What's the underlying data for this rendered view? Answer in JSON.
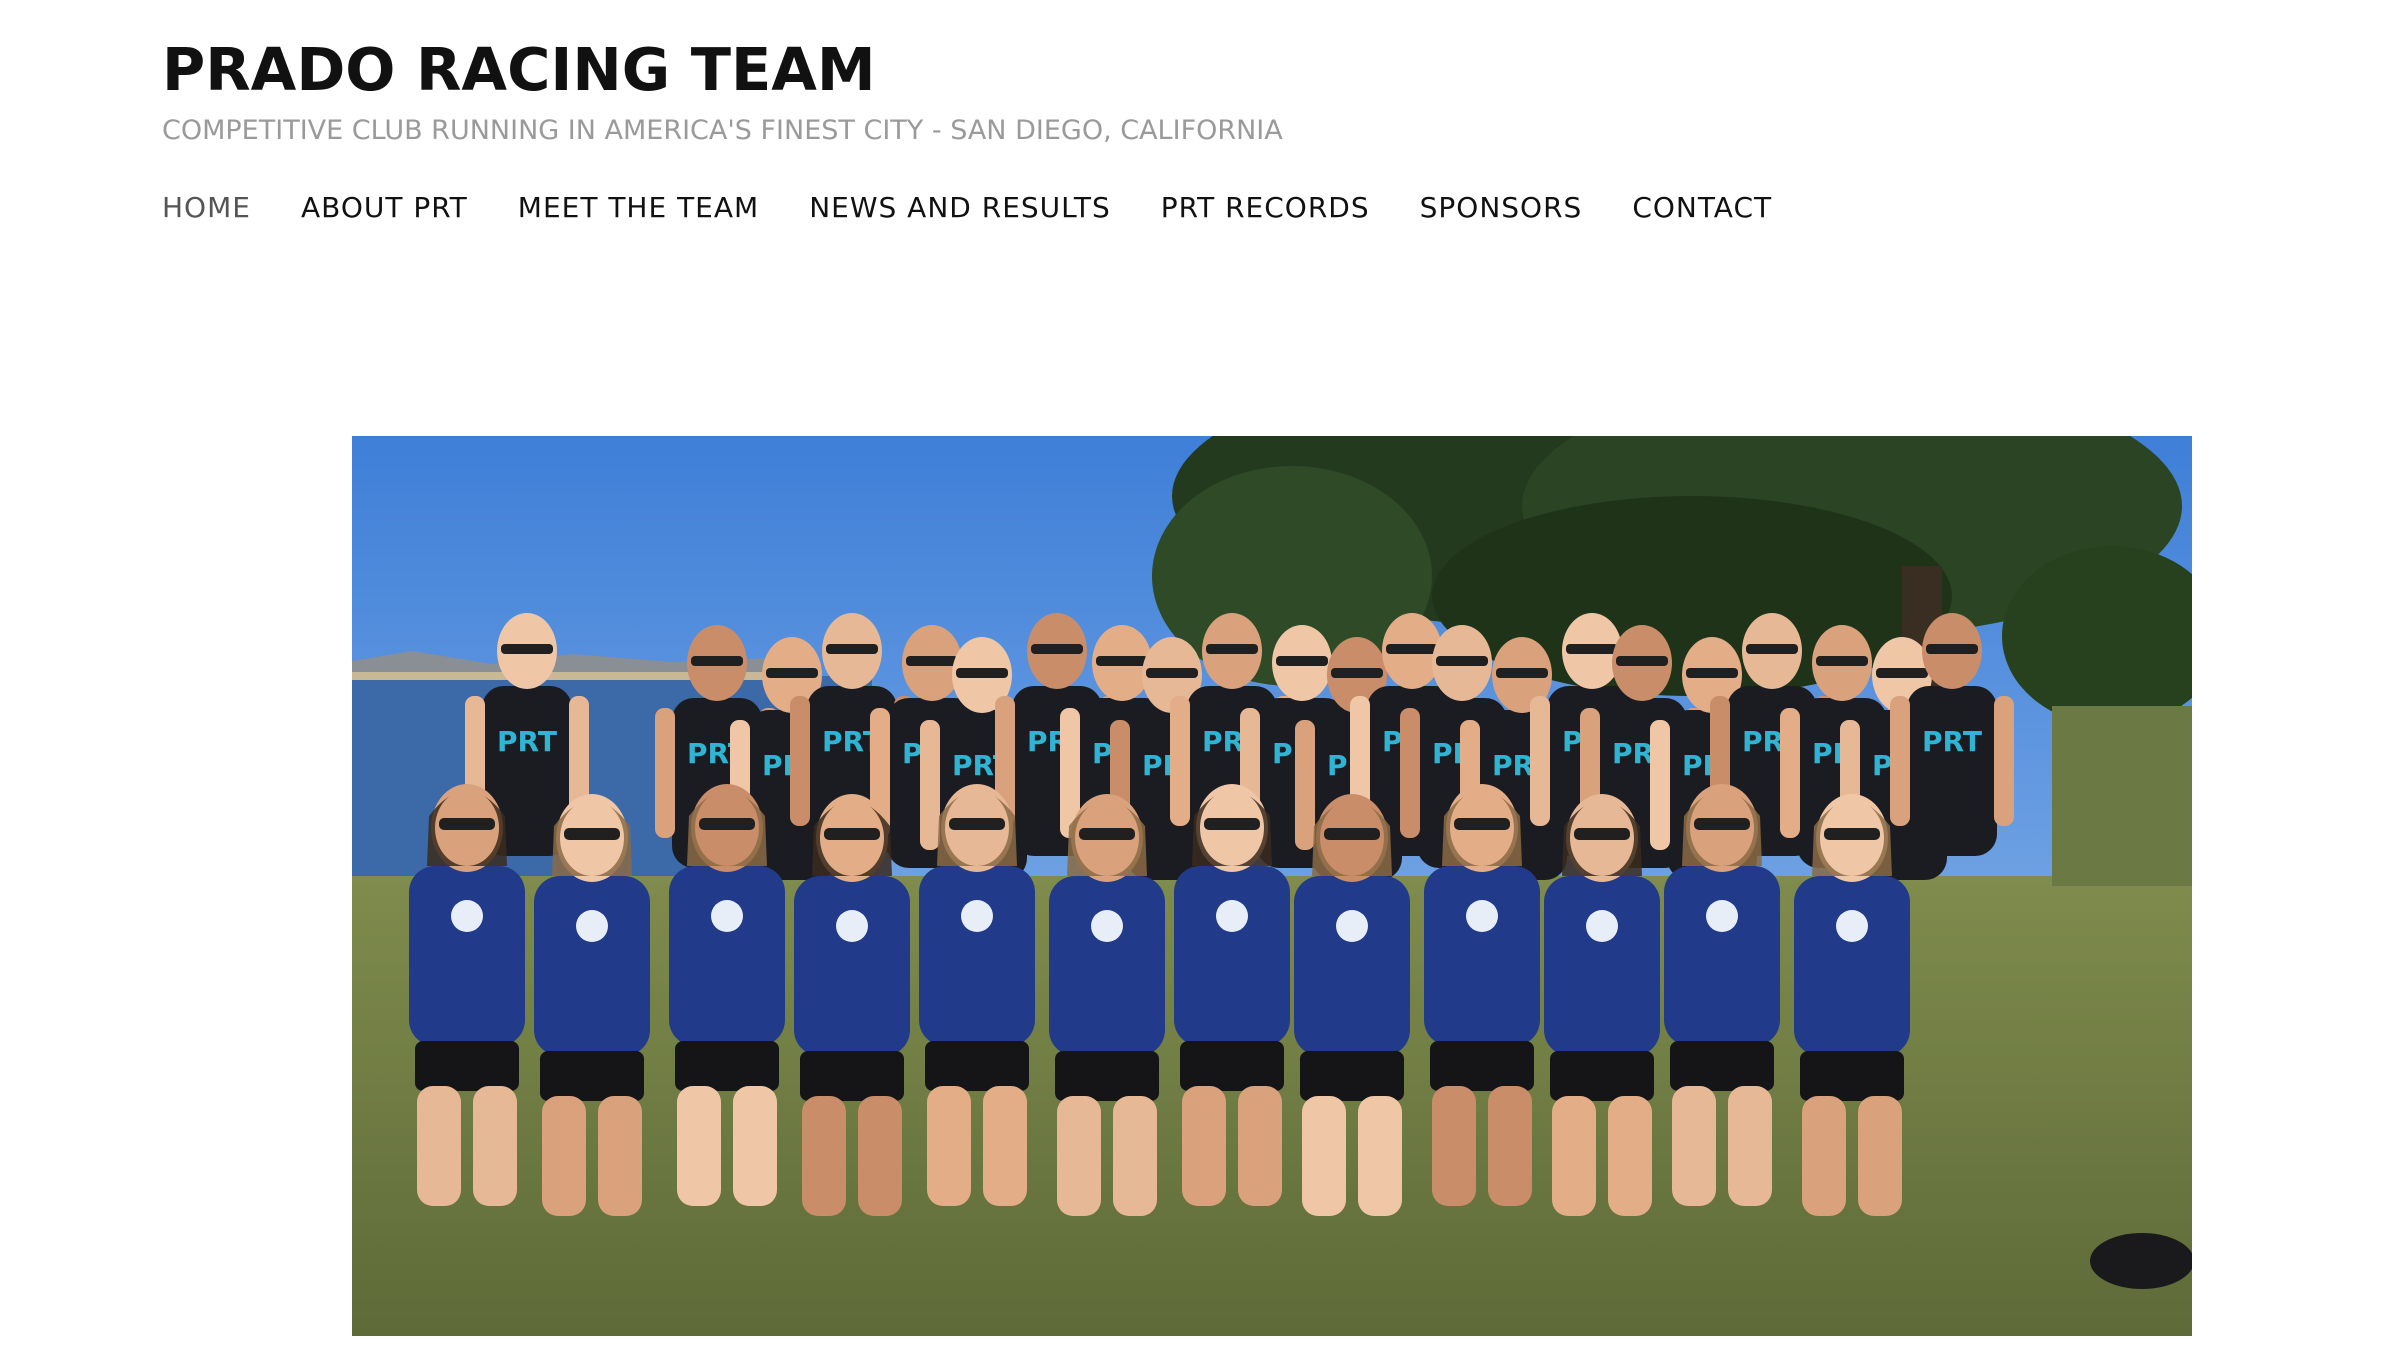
{
  "site": {
    "title": "PRADO RACING TEAM",
    "tagline": "COMPETITIVE CLUB RUNNING IN AMERICA'S FINEST CITY - SAN DIEGO, CALIFORNIA"
  },
  "nav": {
    "items": [
      {
        "label": "HOME",
        "active": true
      },
      {
        "label": "ABOUT PRT"
      },
      {
        "label": "MEET THE TEAM"
      },
      {
        "label": "NEWS AND RESULTS"
      },
      {
        "label": "PRT RECORDS"
      },
      {
        "label": "SPONSORS"
      },
      {
        "label": "CONTACT"
      }
    ]
  },
  "hero": {
    "subject": "team-group-photo",
    "logo_text": "PRT"
  },
  "colors": {
    "title": "#111111",
    "tagline": "#9a9a9a",
    "nav_text": "#111111",
    "nav_active": "#555555",
    "sky": "#5b8fd6",
    "shirt_blue": "#223a8a",
    "singlet_black": "#1b1c22",
    "logo_cyan": "#2fb4d3",
    "grass": "#6f7d45"
  }
}
